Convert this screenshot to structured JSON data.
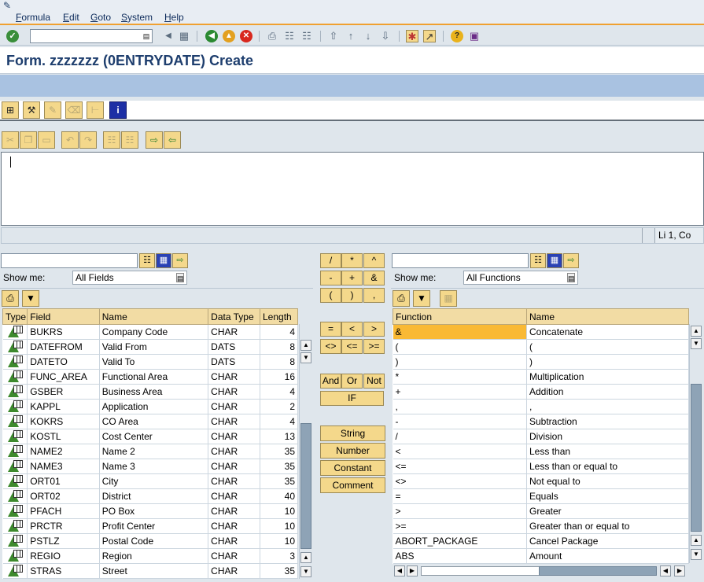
{
  "menu": [
    "Formula",
    "Edit",
    "Goto",
    "System",
    "Help"
  ],
  "command_field": {
    "value": ""
  },
  "title": "Form. zzzzzzz (0ENTRYDATE) Create",
  "editor": {
    "text": "",
    "position": "Li 1, Co"
  },
  "fields_pane": {
    "search_value": "",
    "show_me_label": "Show me:",
    "show_me_value": "All Fields",
    "columns": [
      "Type",
      "Field",
      "Name",
      "Data Type",
      "Length"
    ],
    "rows": [
      {
        "field": "BUKRS",
        "name": "Company Code",
        "type": "CHAR",
        "length": "4"
      },
      {
        "field": "DATEFROM",
        "name": "Valid From",
        "type": "DATS",
        "length": "8"
      },
      {
        "field": "DATETO",
        "name": "Valid To",
        "type": "DATS",
        "length": "8"
      },
      {
        "field": "FUNC_AREA",
        "name": "Functional Area",
        "type": "CHAR",
        "length": "16"
      },
      {
        "field": "GSBER",
        "name": "Business Area",
        "type": "CHAR",
        "length": "4"
      },
      {
        "field": "KAPPL",
        "name": "Application",
        "type": "CHAR",
        "length": "2"
      },
      {
        "field": "KOKRS",
        "name": "CO Area",
        "type": "CHAR",
        "length": "4"
      },
      {
        "field": "KOSTL",
        "name": "Cost Center",
        "type": "CHAR",
        "length": "13"
      },
      {
        "field": "NAME2",
        "name": "Name 2",
        "type": "CHAR",
        "length": "35"
      },
      {
        "field": "NAME3",
        "name": "Name 3",
        "type": "CHAR",
        "length": "35"
      },
      {
        "field": "ORT01",
        "name": "City",
        "type": "CHAR",
        "length": "35"
      },
      {
        "field": "ORT02",
        "name": "District",
        "type": "CHAR",
        "length": "40"
      },
      {
        "field": "PFACH",
        "name": "PO Box",
        "type": "CHAR",
        "length": "10"
      },
      {
        "field": "PRCTR",
        "name": "Profit Center",
        "type": "CHAR",
        "length": "10"
      },
      {
        "field": "PSTLZ",
        "name": "Postal Code",
        "type": "CHAR",
        "length": "10"
      },
      {
        "field": "REGIO",
        "name": "Region",
        "type": "CHAR",
        "length": "3"
      },
      {
        "field": "STRAS",
        "name": "Street",
        "type": "CHAR",
        "length": "35"
      }
    ]
  },
  "operators": {
    "row1": [
      "/",
      "*",
      "^"
    ],
    "row2": [
      "-",
      "+",
      "&"
    ],
    "row3": [
      "(",
      ")",
      ","
    ],
    "row4": [
      "=",
      "<",
      ">"
    ],
    "row5": [
      "<>",
      "<=",
      ">="
    ],
    "logic": [
      "And",
      "Or",
      "Not"
    ],
    "if_label": "IF",
    "literals": [
      "String",
      "Number",
      "Constant",
      "Comment"
    ]
  },
  "functions_pane": {
    "search_value": "",
    "show_me_label": "Show me:",
    "show_me_value": "All Functions",
    "columns": [
      "Function",
      "Name"
    ],
    "rows": [
      {
        "function": "&",
        "name": "Concatenate"
      },
      {
        "function": "(",
        "name": "("
      },
      {
        "function": ")",
        "name": ")"
      },
      {
        "function": "*",
        "name": "Multiplication"
      },
      {
        "function": "+",
        "name": "Addition"
      },
      {
        "function": ",",
        "name": ","
      },
      {
        "function": "-",
        "name": "Subtraction"
      },
      {
        "function": "/",
        "name": "Division"
      },
      {
        "function": "<",
        "name": "Less than"
      },
      {
        "function": "<=",
        "name": "Less than or equal to"
      },
      {
        "function": "<>",
        "name": "Not equal to"
      },
      {
        "function": "=",
        "name": "Equals"
      },
      {
        "function": ">",
        "name": "Greater"
      },
      {
        "function": ">=",
        "name": "Greater than or equal to"
      },
      {
        "function": "ABORT_PACKAGE",
        "name": "Cancel Package"
      },
      {
        "function": "ABS",
        "name": "Amount"
      }
    ]
  },
  "colors": {
    "accent_orange": "#f0a030",
    "header_band": "#a9c2e1",
    "title_blue": "#1e3e6e",
    "selected_cell": "#f9b934"
  },
  "icons": {
    "enter": "check-icon",
    "back": "back-icon",
    "exit": "exit-icon",
    "cancel": "cancel-icon",
    "print": "print-icon",
    "find": "find-icon",
    "help": "help-icon",
    "layout": "layout-icon"
  }
}
